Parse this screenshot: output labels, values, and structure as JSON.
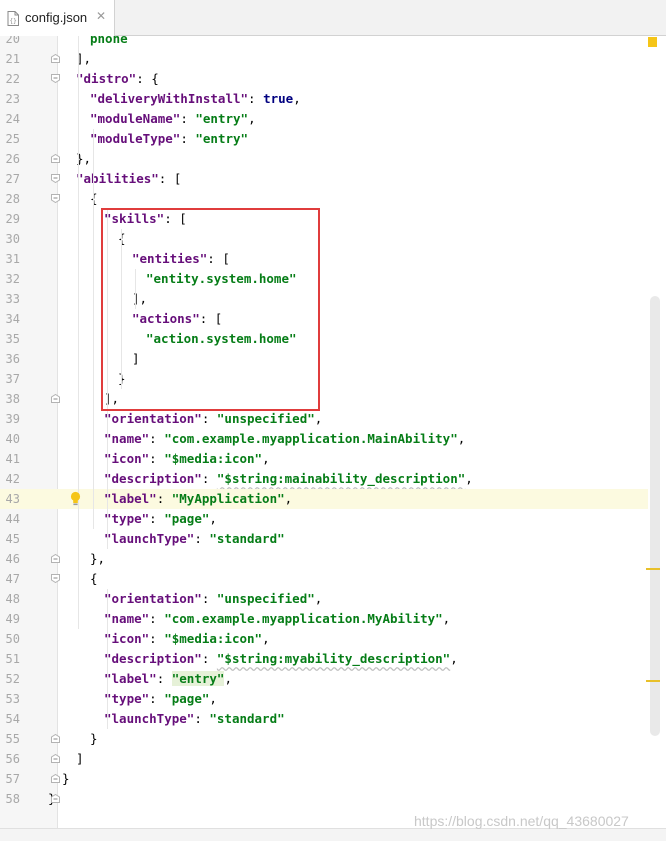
{
  "tab": {
    "label": "config.json",
    "close": "✕"
  },
  "current_line": 43,
  "lines": [
    {
      "n": "20",
      "t": [
        [
          "s",
          "phone"
        ]
      ]
    },
    {
      "n": "21",
      "t": [
        [
          "p",
          "],"
        ]
      ]
    },
    {
      "n": "22",
      "t": [
        [
          "k",
          "\"distro\""
        ],
        [
          "p",
          ": {"
        ]
      ]
    },
    {
      "n": "23",
      "t": [
        [
          "k",
          "\"deliveryWithInstall\""
        ],
        [
          "p",
          ": "
        ],
        [
          "b",
          "true"
        ],
        [
          "p",
          ","
        ]
      ]
    },
    {
      "n": "24",
      "t": [
        [
          "k",
          "\"moduleName\""
        ],
        [
          "p",
          ": "
        ],
        [
          "s",
          "\"entry\""
        ],
        [
          "p",
          ","
        ]
      ]
    },
    {
      "n": "25",
      "t": [
        [
          "k",
          "\"moduleType\""
        ],
        [
          "p",
          ": "
        ],
        [
          "s",
          "\"entry\""
        ]
      ]
    },
    {
      "n": "26",
      "t": [
        [
          "p",
          "},"
        ]
      ]
    },
    {
      "n": "27",
      "t": [
        [
          "k",
          "\"abilities\""
        ],
        [
          "p",
          ": ["
        ]
      ]
    },
    {
      "n": "28",
      "t": [
        [
          "p",
          "{"
        ]
      ]
    },
    {
      "n": "29",
      "t": [
        [
          "k",
          "\"skills\""
        ],
        [
          "p",
          ": ["
        ]
      ]
    },
    {
      "n": "30",
      "t": [
        [
          "p",
          "{"
        ]
      ]
    },
    {
      "n": "31",
      "t": [
        [
          "k",
          "\"entities\""
        ],
        [
          "p",
          ": ["
        ]
      ]
    },
    {
      "n": "32",
      "t": [
        [
          "s",
          "\"entity.system.home\""
        ]
      ]
    },
    {
      "n": "33",
      "t": [
        [
          "p",
          "],"
        ]
      ]
    },
    {
      "n": "34",
      "t": [
        [
          "k",
          "\"actions\""
        ],
        [
          "p",
          ": ["
        ]
      ]
    },
    {
      "n": "35",
      "t": [
        [
          "s",
          "\"action.system.home\""
        ]
      ]
    },
    {
      "n": "36",
      "t": [
        [
          "p",
          "]"
        ]
      ]
    },
    {
      "n": "37",
      "t": [
        [
          "p",
          "}"
        ]
      ]
    },
    {
      "n": "38",
      "t": [
        [
          "p",
          "],"
        ]
      ]
    },
    {
      "n": "39",
      "t": [
        [
          "k",
          "\"orientation\""
        ],
        [
          "p",
          ": "
        ],
        [
          "s",
          "\"unspecified\""
        ],
        [
          "p",
          ","
        ]
      ]
    },
    {
      "n": "40",
      "t": [
        [
          "k",
          "\"name\""
        ],
        [
          "p",
          ": "
        ],
        [
          "s",
          "\"com.example.myapplication.MainAbility\""
        ],
        [
          "p",
          ","
        ]
      ]
    },
    {
      "n": "41",
      "t": [
        [
          "k",
          "\"icon\""
        ],
        [
          "p",
          ": "
        ],
        [
          "s",
          "\"$media:icon\""
        ],
        [
          "p",
          ","
        ]
      ]
    },
    {
      "n": "42",
      "t": [
        [
          "k",
          "\"description\""
        ],
        [
          "p",
          ": "
        ],
        [
          "s",
          "\"$string:mainability_description\""
        ],
        [
          "p",
          ","
        ]
      ]
    },
    {
      "n": "43",
      "t": [
        [
          "k",
          "\"label\""
        ],
        [
          "p",
          ": "
        ],
        [
          "s",
          "\"MyApplication\""
        ],
        [
          "p",
          ","
        ]
      ]
    },
    {
      "n": "44",
      "t": [
        [
          "k",
          "\"type\""
        ],
        [
          "p",
          ": "
        ],
        [
          "s",
          "\"page\""
        ],
        [
          "p",
          ","
        ]
      ]
    },
    {
      "n": "45",
      "t": [
        [
          "k",
          "\"launchType\""
        ],
        [
          "p",
          ": "
        ],
        [
          "s",
          "\"standard\""
        ]
      ]
    },
    {
      "n": "46",
      "t": [
        [
          "p",
          "},"
        ]
      ]
    },
    {
      "n": "47",
      "t": [
        [
          "p",
          "{"
        ]
      ]
    },
    {
      "n": "48",
      "t": [
        [
          "k",
          "\"orientation\""
        ],
        [
          "p",
          ": "
        ],
        [
          "s",
          "\"unspecified\""
        ],
        [
          "p",
          ","
        ]
      ]
    },
    {
      "n": "49",
      "t": [
        [
          "k",
          "\"name\""
        ],
        [
          "p",
          ": "
        ],
        [
          "s",
          "\"com.example.myapplication.MyAbility\""
        ],
        [
          "p",
          ","
        ]
      ]
    },
    {
      "n": "50",
      "t": [
        [
          "k",
          "\"icon\""
        ],
        [
          "p",
          ": "
        ],
        [
          "s",
          "\"$media:icon\""
        ],
        [
          "p",
          ","
        ]
      ]
    },
    {
      "n": "51",
      "t": [
        [
          "k",
          "\"description\""
        ],
        [
          "p",
          ": "
        ],
        [
          "s",
          "\"$string:myability_description\""
        ],
        [
          "p",
          ","
        ]
      ]
    },
    {
      "n": "52",
      "t": [
        [
          "k",
          "\"label\""
        ],
        [
          "p",
          ": "
        ],
        [
          "s",
          "\"entry\""
        ],
        [
          "p",
          ","
        ]
      ]
    },
    {
      "n": "53",
      "t": [
        [
          "k",
          "\"type\""
        ],
        [
          "p",
          ": "
        ],
        [
          "s",
          "\"page\""
        ],
        [
          "p",
          ","
        ]
      ]
    },
    {
      "n": "54",
      "t": [
        [
          "k",
          "\"launchType\""
        ],
        [
          "p",
          ": "
        ],
        [
          "s",
          "\"standard\""
        ]
      ]
    },
    {
      "n": "55",
      "t": [
        [
          "p",
          "}"
        ]
      ]
    },
    {
      "n": "56",
      "t": [
        [
          "p",
          "]"
        ]
      ]
    },
    {
      "n": "57",
      "t": [
        [
          "p",
          "}"
        ]
      ]
    },
    {
      "n": "58",
      "t": [
        [
          "p",
          "}"
        ]
      ]
    }
  ],
  "watermark": "https://blog.csdn.net/qq_43680027",
  "colors": {
    "key": "#660e7a",
    "string": "#067d17",
    "boolean": "#000080",
    "highlight_box": "#e03c3c"
  }
}
